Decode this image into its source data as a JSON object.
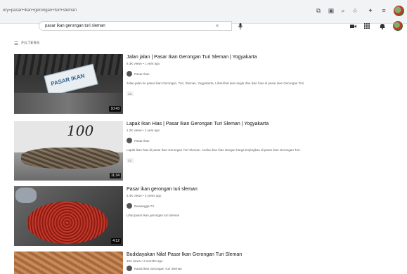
{
  "browser": {
    "url": "ery=pasar+ikan+gerongan+turi+sleman",
    "icons": [
      "translate-icon",
      "extension-icon",
      "zoom-icon",
      "star-icon",
      "puzzle-icon",
      "menu-icon"
    ]
  },
  "header": {
    "search_value": "pasar ikan gerongan turi sleman",
    "clear_glyph": "✕",
    "mic_glyph": "🎤"
  },
  "filters": {
    "label": "FILTERS",
    "glyph": "☰"
  },
  "results": [
    {
      "title": "Jalan jalan | Pasar Ikan Gerongan Turi Sleman | Yogyakarta",
      "meta": "8.3K views • 1 year ago",
      "channel": "Pasar Ikan",
      "description": "Jalan-jalan ke pasar ikan Gerongan, Turi, Sleman, Yogyakarta. Lihat-lihat ikan segar dan ikan hias di pasar ikan Gerongan Turi.",
      "badge": "CC",
      "duration": "10:43",
      "sign_text": "PASAR IKAN"
    },
    {
      "title": "Lapak Ikan Hias | Pasar Ikan Gerongan Turi Sleman | Yogyakarta",
      "meta": "1.2K views • 1 year ago",
      "channel": "Pasar Ikan",
      "description": "Lapak ikan hias di pasar ikan Gerongan Turi Sleman. Aneka ikan hias dengan harga terjangkau di pasar ikan Gerongan Turi.",
      "badge": "CC",
      "duration": "11:34",
      "thumb_text": "100"
    },
    {
      "title": "Pasar ikan gerongan turi sleman",
      "meta": "2.4K views • 3 years ago",
      "channel": "Dewangga TV",
      "description": "Lihat pasar ikan gerongan turi sleman",
      "badge": "",
      "duration": "4:12"
    },
    {
      "title": "Budidayakan Nila! Pasar Ikan Gerongan Turi Sleman",
      "meta": "102 views • 2 months ago",
      "channel": "Kanal Ikan Gerongan Turi Sleman",
      "description": "",
      "badge": "",
      "duration": ""
    }
  ]
}
